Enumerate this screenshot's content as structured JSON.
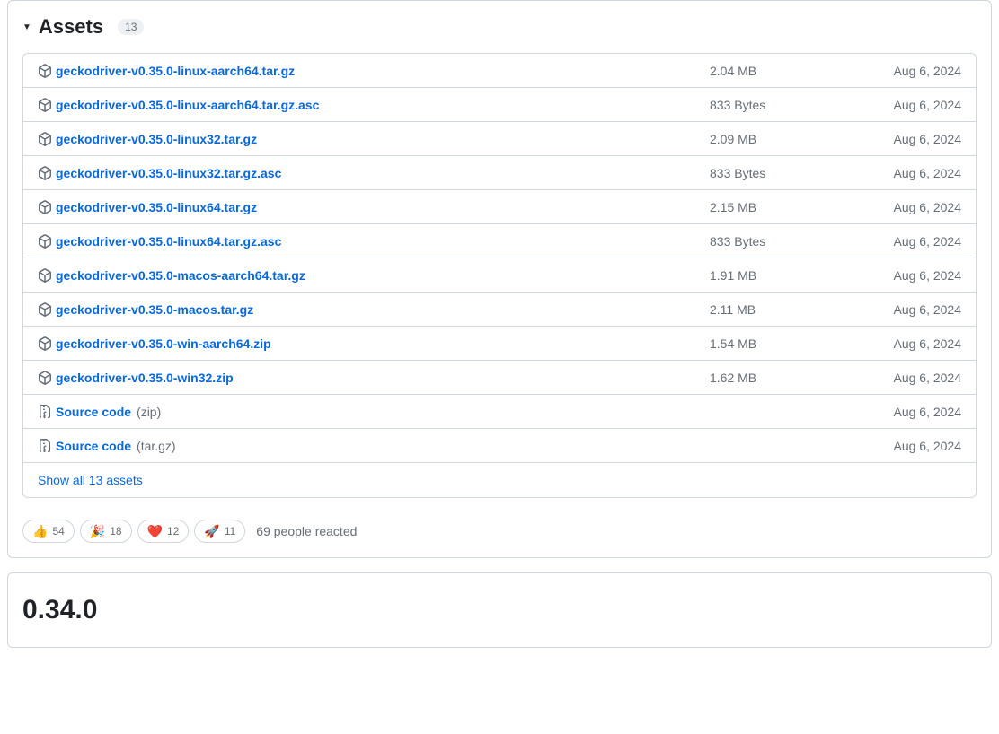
{
  "assets_section": {
    "title": "Assets",
    "count": "13",
    "show_all_label": "Show all 13 assets"
  },
  "assets": [
    {
      "name": "geckodriver-v0.35.0-linux-aarch64.tar.gz",
      "size": "2.04 MB",
      "date": "Aug 6, 2024",
      "icon": "package"
    },
    {
      "name": "geckodriver-v0.35.0-linux-aarch64.tar.gz.asc",
      "size": "833 Bytes",
      "date": "Aug 6, 2024",
      "icon": "package"
    },
    {
      "name": "geckodriver-v0.35.0-linux32.tar.gz",
      "size": "2.09 MB",
      "date": "Aug 6, 2024",
      "icon": "package"
    },
    {
      "name": "geckodriver-v0.35.0-linux32.tar.gz.asc",
      "size": "833 Bytes",
      "date": "Aug 6, 2024",
      "icon": "package"
    },
    {
      "name": "geckodriver-v0.35.0-linux64.tar.gz",
      "size": "2.15 MB",
      "date": "Aug 6, 2024",
      "icon": "package"
    },
    {
      "name": "geckodriver-v0.35.0-linux64.tar.gz.asc",
      "size": "833 Bytes",
      "date": "Aug 6, 2024",
      "icon": "package"
    },
    {
      "name": "geckodriver-v0.35.0-macos-aarch64.tar.gz",
      "size": "1.91 MB",
      "date": "Aug 6, 2024",
      "icon": "package"
    },
    {
      "name": "geckodriver-v0.35.0-macos.tar.gz",
      "size": "2.11 MB",
      "date": "Aug 6, 2024",
      "icon": "package"
    },
    {
      "name": "geckodriver-v0.35.0-win-aarch64.zip",
      "size": "1.54 MB",
      "date": "Aug 6, 2024",
      "icon": "package"
    },
    {
      "name": "geckodriver-v0.35.0-win32.zip",
      "size": "1.62 MB",
      "date": "Aug 6, 2024",
      "icon": "package"
    },
    {
      "name": "Source code",
      "format": "(zip)",
      "size": "",
      "date": "Aug 6, 2024",
      "icon": "zip"
    },
    {
      "name": "Source code",
      "format": "(tar.gz)",
      "size": "",
      "date": "Aug 6, 2024",
      "icon": "zip"
    }
  ],
  "reactions": [
    {
      "emoji": "👍",
      "count": "54"
    },
    {
      "emoji": "🎉",
      "count": "18"
    },
    {
      "emoji": "❤️",
      "count": "12"
    },
    {
      "emoji": "🚀",
      "count": "11"
    }
  ],
  "reactions_summary": "69 people reacted",
  "next_release": {
    "title": "0.34.0"
  }
}
